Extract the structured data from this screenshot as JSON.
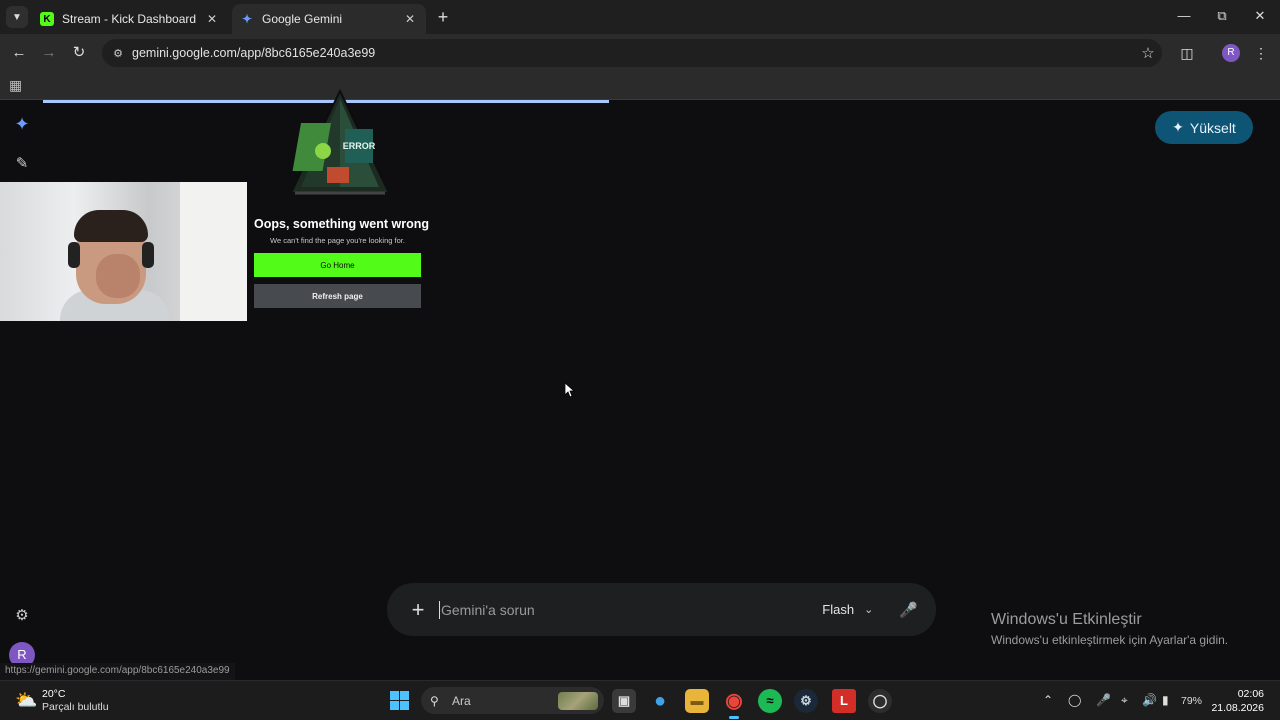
{
  "tabs": [
    {
      "title": "Stream - Kick Dashboard",
      "favicon": "kick-logo-icon",
      "active": false
    },
    {
      "title": "Google Gemini",
      "favicon": "gemini-sparkle-icon",
      "active": true
    }
  ],
  "toolbar": {
    "url": "gemini.google.com/app/8bc6165e240a3e99",
    "profile_initial": "R"
  },
  "gemini": {
    "upgrade_label": "Yükselt",
    "prompt_placeholder": "Gemini'a sorun",
    "model_label": "Flash",
    "avatar_initial": "R"
  },
  "overlay": {
    "error_title": "Oops, something went wrong",
    "error_subtitle": "We can't find the page you're looking for.",
    "go_home_label": "Go Home",
    "refresh_label": "Refresh page",
    "sign_text": "ERROR",
    "accent_color": "#53fc18"
  },
  "windows": {
    "activate_title": "Windows'u Etkinleştir",
    "activate_subtitle": "Windows'u etkinleştirmek için Ayarlar'a gidin."
  },
  "status_url": "https://gemini.google.com/app/8bc6165e240a3e99",
  "taskbar": {
    "weather_temp": "20°C",
    "weather_desc": "Parçalı bulutlu",
    "search_label": "Ara",
    "battery": "79%",
    "time": "02:06",
    "date": "21.08.2026",
    "pinned_apps": [
      "file-explorer-icon",
      "edge-icon",
      "folder-icon",
      "chrome-icon",
      "spotify-icon",
      "steam-icon",
      "lastpass-icon",
      "obs-icon"
    ]
  }
}
